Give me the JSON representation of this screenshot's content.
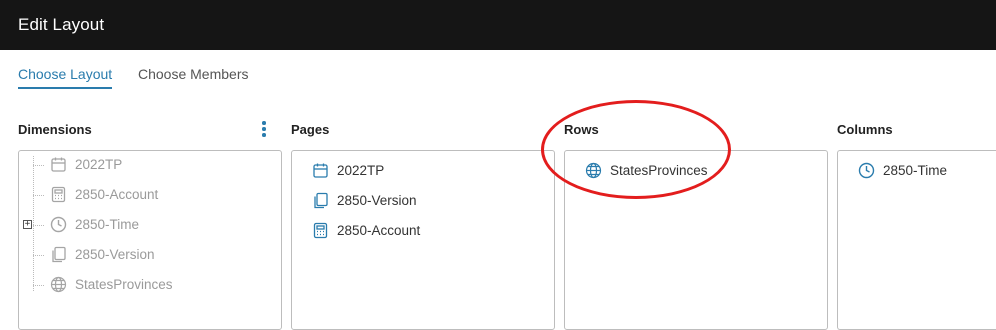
{
  "window": {
    "title": "Edit Layout"
  },
  "tabs": [
    {
      "label": "Choose Layout",
      "active": true
    },
    {
      "label": "Choose Members",
      "active": false
    }
  ],
  "sections": {
    "dimensions": {
      "label": "Dimensions",
      "items": [
        {
          "label": "2022TP",
          "icon": "calendar-icon"
        },
        {
          "label": "2850-Account",
          "icon": "calculator-icon"
        },
        {
          "label": "2850-Time",
          "icon": "clock-icon"
        },
        {
          "label": "2850-Version",
          "icon": "copy-icon"
        },
        {
          "label": "StatesProvinces",
          "icon": "globe-icon"
        }
      ]
    },
    "pages": {
      "label": "Pages",
      "items": [
        {
          "label": "2022TP",
          "icon": "calendar-icon"
        },
        {
          "label": "2850-Version",
          "icon": "copy-icon"
        },
        {
          "label": "2850-Account",
          "icon": "calculator-icon"
        }
      ]
    },
    "rows": {
      "label": "Rows",
      "items": [
        {
          "label": "StatesProvinces",
          "icon": "globe-icon"
        }
      ]
    },
    "columns": {
      "label": "Columns",
      "items": [
        {
          "label": "2850-Time",
          "icon": "clock-icon"
        }
      ]
    }
  },
  "colors": {
    "accent": "#2a7cad",
    "titlebar": "#151515",
    "annotation": "#e31d1d"
  }
}
